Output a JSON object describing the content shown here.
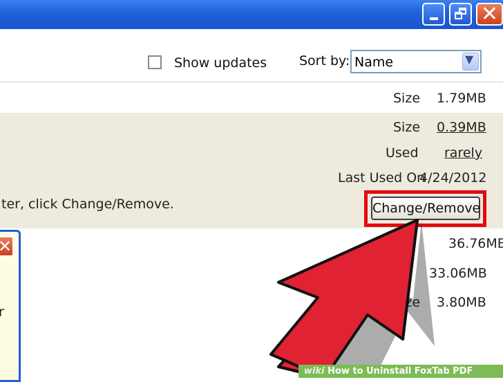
{
  "window": {
    "controls": [
      "minimize",
      "maximize",
      "close"
    ]
  },
  "toolbar": {
    "show_updates_label": "Show updates",
    "sort_by_label": "Sort by:",
    "sort_value": "Name"
  },
  "program_rows": [
    {
      "size_label": "Size",
      "size_value": "1.79MB"
    }
  ],
  "selected_program": {
    "size_label": "Size",
    "size_value": "0.39MB",
    "used_label": "Used",
    "used_value": "rarely",
    "last_used_label": "Last Used On",
    "last_used_value": "4/24/2012",
    "instruction_fragment": "ter, click Change/Remove.",
    "change_remove_label": "Change/Remove"
  },
  "other_rows": [
    {
      "size_value": "36.76MB"
    },
    {
      "size_value": "33.06MB"
    },
    {
      "size_label": "Size",
      "size_value": "3.80MB"
    }
  ],
  "dialog": {
    "close_glyph": "✕",
    "text_fragment": "r"
  },
  "footer": {
    "brand": "wiki",
    "title": "How to Uninstall FoxTab PDF Creator"
  },
  "colors": {
    "titlebar": "#1f5fd8",
    "selected_row": "#eeeadd",
    "highlight": "#e20b12",
    "arrow": "#e02232",
    "footer": "#7cbb55"
  }
}
